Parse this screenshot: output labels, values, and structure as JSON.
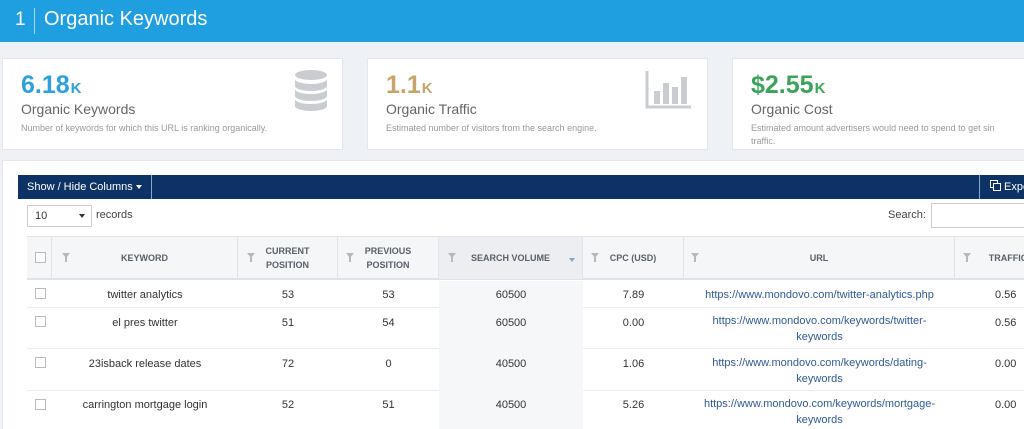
{
  "header": {
    "number": "1",
    "title": "Organic Keywords"
  },
  "cards": [
    {
      "value": "6.18",
      "suffix": "K",
      "color": "#2ea0dd",
      "label": "Organic Keywords",
      "desc": "Number of keywords for which this URL is ranking organically.",
      "icon": "database-icon"
    },
    {
      "value": "1.1",
      "suffix": "K",
      "color": "#c9a46a",
      "label": "Organic Traffic",
      "desc": "Estimated number of visitors from the search engine.",
      "icon": "bar-chart-icon"
    },
    {
      "value": "$2.55",
      "suffix": "K",
      "color": "#3aa558",
      "label": "Organic Cost",
      "desc_line1": "Estimated amount advertisers would need to spend to get sin",
      "desc_line2": "traffic.",
      "icon": "none"
    }
  ],
  "toolbar": {
    "show_hide": "Show / Hide Columns",
    "export": "Expo"
  },
  "controls": {
    "page_length": "10",
    "records_label": "records",
    "search_label": "Search:",
    "search_value": ""
  },
  "table": {
    "columns": {
      "keyword": "KEYWORD",
      "current_position_1": "CURRENT",
      "current_position_2": "POSITION",
      "previous_position_1": "PREVIOUS",
      "previous_position_2": "POSITION",
      "search_volume": "SEARCH VOLUME",
      "cpc": "CPC (USD)",
      "url": "URL",
      "traffic": "TRAFFIC"
    },
    "rows": [
      {
        "keyword": "twitter analytics",
        "current": "53",
        "previous": "53",
        "volume": "60500",
        "cpc": "7.89",
        "url1": "https://www.mondovo.com/twitter-analytics.php",
        "url2": "",
        "traffic": "0.56"
      },
      {
        "keyword": "el pres twitter",
        "current": "51",
        "previous": "54",
        "volume": "60500",
        "cpc": "0.00",
        "url1": "https://www.mondovo.com/keywords/twitter-",
        "url2": "keywords",
        "traffic": "0.56"
      },
      {
        "keyword": "23isback release dates",
        "current": "72",
        "previous": "0",
        "volume": "40500",
        "cpc": "1.06",
        "url1": "https://www.mondovo.com/keywords/dating-",
        "url2": "keywords",
        "traffic": "0.00"
      },
      {
        "keyword": "carrington mortgage login",
        "current": "52",
        "previous": "51",
        "volume": "40500",
        "cpc": "5.26",
        "url1": "https://www.mondovo.com/keywords/mortgage-",
        "url2": "keywords",
        "traffic": "0.00"
      }
    ]
  }
}
